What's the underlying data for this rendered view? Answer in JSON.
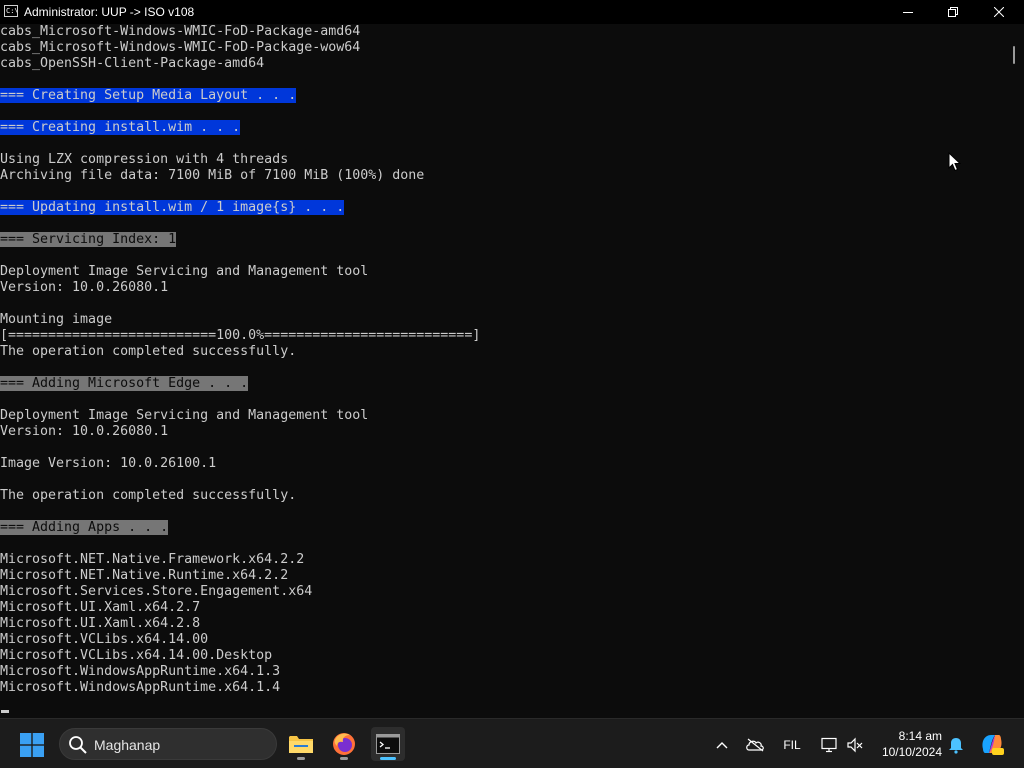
{
  "window": {
    "title": "Administrator:  UUP -> ISO v108",
    "icon_text": "C:\\"
  },
  "terminal": {
    "lines": [
      {
        "text": "cabs_Microsoft-Windows-WMIC-FoD-Package-amd64",
        "hl": ""
      },
      {
        "text": "cabs_Microsoft-Windows-WMIC-FoD-Package-wow64",
        "hl": ""
      },
      {
        "text": "cabs_OpenSSH-Client-Package-amd64",
        "hl": ""
      },
      {
        "text": "",
        "hl": ""
      },
      {
        "text": "=== Creating Setup Media Layout . . .",
        "hl": "blue"
      },
      {
        "text": "",
        "hl": ""
      },
      {
        "text": "=== Creating install.wim . . .",
        "hl": "blue"
      },
      {
        "text": "",
        "hl": ""
      },
      {
        "text": "Using LZX compression with 4 threads",
        "hl": ""
      },
      {
        "text": "Archiving file data: 7100 MiB of 7100 MiB (100%) done",
        "hl": ""
      },
      {
        "text": "",
        "hl": ""
      },
      {
        "text": "=== Updating install.wim / 1 image{s} . . .",
        "hl": "blue"
      },
      {
        "text": "",
        "hl": ""
      },
      {
        "text": "=== Servicing Index: 1",
        "hl": "gray"
      },
      {
        "text": "",
        "hl": ""
      },
      {
        "text": "Deployment Image Servicing and Management tool",
        "hl": ""
      },
      {
        "text": "Version: 10.0.26080.1",
        "hl": ""
      },
      {
        "text": "",
        "hl": ""
      },
      {
        "text": "Mounting image",
        "hl": ""
      },
      {
        "text": "[==========================100.0%==========================]",
        "hl": ""
      },
      {
        "text": "The operation completed successfully.",
        "hl": ""
      },
      {
        "text": "",
        "hl": ""
      },
      {
        "text": "=== Adding Microsoft Edge . . .",
        "hl": "gray"
      },
      {
        "text": "",
        "hl": ""
      },
      {
        "text": "Deployment Image Servicing and Management tool",
        "hl": ""
      },
      {
        "text": "Version: 10.0.26080.1",
        "hl": ""
      },
      {
        "text": "",
        "hl": ""
      },
      {
        "text": "Image Version: 10.0.26100.1",
        "hl": ""
      },
      {
        "text": "",
        "hl": ""
      },
      {
        "text": "The operation completed successfully.",
        "hl": ""
      },
      {
        "text": "",
        "hl": ""
      },
      {
        "text": "=== Adding Apps . . .",
        "hl": "gray"
      },
      {
        "text": "",
        "hl": ""
      },
      {
        "text": "Microsoft.NET.Native.Framework.x64.2.2",
        "hl": ""
      },
      {
        "text": "Microsoft.NET.Native.Runtime.x64.2.2",
        "hl": ""
      },
      {
        "text": "Microsoft.Services.Store.Engagement.x64",
        "hl": ""
      },
      {
        "text": "Microsoft.UI.Xaml.x64.2.7",
        "hl": ""
      },
      {
        "text": "Microsoft.UI.Xaml.x64.2.8",
        "hl": ""
      },
      {
        "text": "Microsoft.VCLibs.x64.14.00",
        "hl": ""
      },
      {
        "text": "Microsoft.VCLibs.x64.14.00.Desktop",
        "hl": ""
      },
      {
        "text": "Microsoft.WindowsAppRuntime.x64.1.3",
        "hl": ""
      },
      {
        "text": "Microsoft.WindowsAppRuntime.x64.1.4",
        "hl": ""
      }
    ]
  },
  "colors": {
    "terminal_bg": "#0c0c0c",
    "terminal_fg": "#cccccc",
    "highlight_blue": "#0037da",
    "highlight_gray": "#767676",
    "taskbar_bg": "#1c1c1c",
    "accent": "#4cc2ff"
  },
  "taskbar": {
    "search_placeholder": "Maghanap",
    "apps": [
      {
        "icon": "file-explorer-icon"
      },
      {
        "icon": "firefox-icon"
      },
      {
        "icon": "terminal-icon"
      }
    ],
    "tray": {
      "language": "FIL",
      "time": "8:14 am",
      "date": "10/10/2024"
    }
  }
}
